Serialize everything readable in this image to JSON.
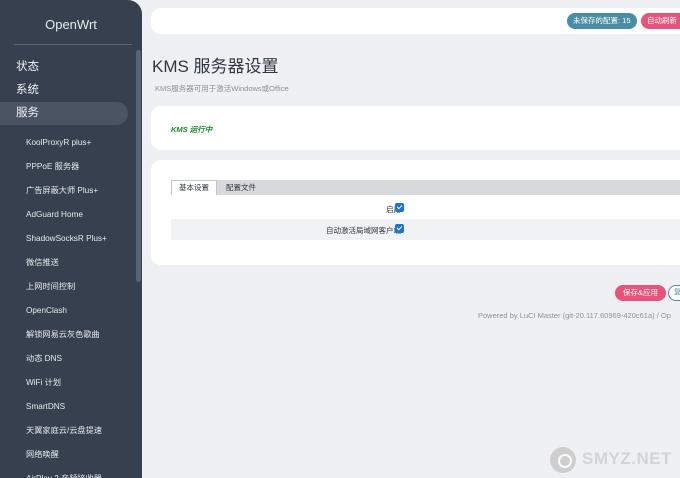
{
  "sidebar": {
    "brand": "OpenWrt",
    "top_items": [
      {
        "label": "状态"
      },
      {
        "label": "系统"
      },
      {
        "label": "服务"
      }
    ],
    "sub_items": [
      {
        "label": "KoolProxyR plus+"
      },
      {
        "label": "PPPoE 服务器"
      },
      {
        "label": "广告屏蔽大师 Plus+"
      },
      {
        "label": "AdGuard Home"
      },
      {
        "label": "ShadowSocksR Plus+"
      },
      {
        "label": "微信推送"
      },
      {
        "label": "上网时间控制"
      },
      {
        "label": "OpenClash"
      },
      {
        "label": "解锁网易云灰色歌曲"
      },
      {
        "label": "动态 DNS"
      },
      {
        "label": "WiFi 计划"
      },
      {
        "label": "SmartDNS"
      },
      {
        "label": "天翼家庭云/云盘提速"
      },
      {
        "label": "网络唤醒"
      },
      {
        "label": "AirPlay 2 音频接收器"
      }
    ]
  },
  "topbar": {
    "unsaved": "未保存的配置: 15",
    "refresh": "自动刷新"
  },
  "page": {
    "title": "KMS 服务器设置",
    "description": "KMS服务器可用于激活Windows或Office",
    "status": "KMS 运行中"
  },
  "settings": {
    "tabs": [
      {
        "label": "基本设置"
      },
      {
        "label": "配置文件"
      }
    ],
    "rows": [
      {
        "label": "启用",
        "checked": true
      },
      {
        "label": "自动激活局域网客户端",
        "checked": true
      }
    ]
  },
  "footer": {
    "save_apply": "保存&应用",
    "second_button": "复",
    "powered": "Powered by LuCI Master (git-20.117.60969-420c61a) / Op"
  },
  "watermark": {
    "text": "SMYZ.NET"
  }
}
